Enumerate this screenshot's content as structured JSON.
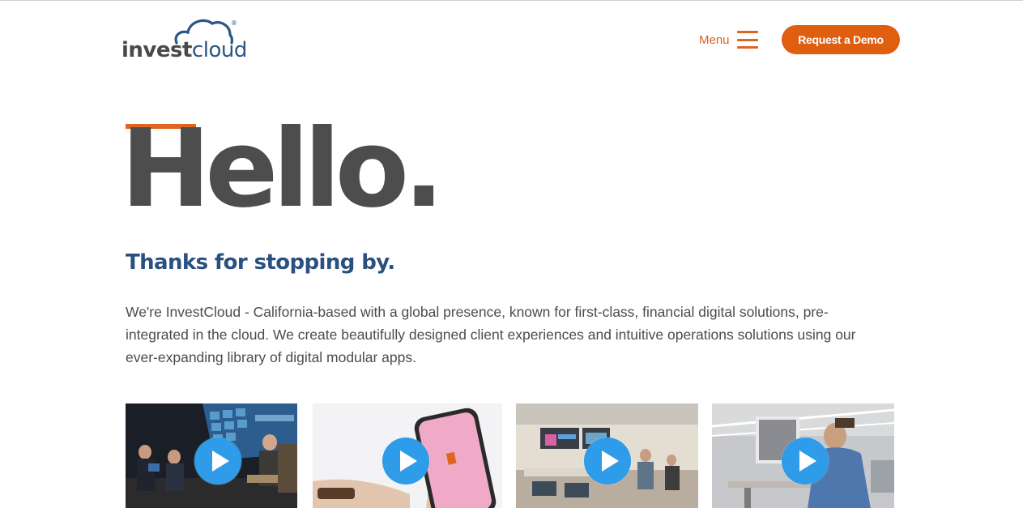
{
  "header": {
    "logo": {
      "word_bold": "invest",
      "word_light": "cloud",
      "registered_mark": "®"
    },
    "menu_label": "Menu",
    "demo_button_label": "Request a Demo"
  },
  "hero": {
    "title": "Hello.",
    "subtitle": "Thanks for stopping by.",
    "intro": "We're InvestCloud - California-based with a global presence, known for first-class, financial digital solutions, pre-integrated in the cloud. We create beautifully designed client experiences and intuitive operations solutions using our ever-expanding library of digital modular apps."
  },
  "videos": [
    {
      "name": "video-conference-panel",
      "icon": "play-icon"
    },
    {
      "name": "video-mobile-app",
      "icon": "play-icon"
    },
    {
      "name": "video-office-meeting",
      "icon": "play-icon"
    },
    {
      "name": "video-office-developer",
      "icon": "play-icon"
    }
  ],
  "colors": {
    "accent": "#e0651f",
    "button": "#e05e0f",
    "heading_gray": "#4d4d4d",
    "subtitle_blue": "#2a5081",
    "play_blue": "#2f9cea"
  }
}
